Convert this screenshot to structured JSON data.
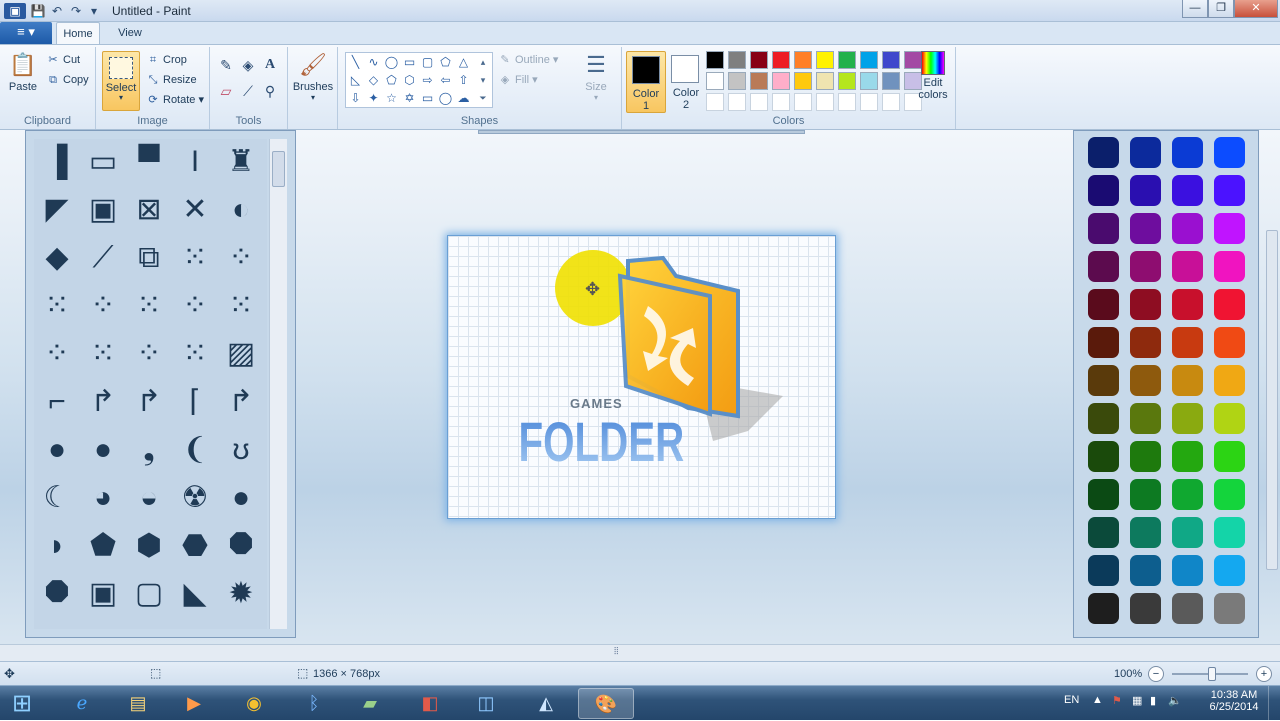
{
  "window": {
    "title": "Untitled - Paint",
    "file_menu": "≡ ▾",
    "minimize": "—",
    "maximize": "❐",
    "close": "✕"
  },
  "quick_access": [
    "💾",
    "↶",
    "↷",
    "▾"
  ],
  "tabs": [
    {
      "label": "Home",
      "active": true
    },
    {
      "label": "View",
      "active": false
    }
  ],
  "ribbon": {
    "clipboard": {
      "label": "Clipboard",
      "paste": "Paste",
      "cut": "Cut",
      "copy": "Copy"
    },
    "image": {
      "label": "Image",
      "select": "Select",
      "crop": "Crop",
      "resize": "Resize",
      "rotate": "Rotate"
    },
    "tools": {
      "label": "Tools"
    },
    "brushes": {
      "label": "Brushes"
    },
    "shapes": {
      "label": "Shapes",
      "outline": "Outline",
      "fill": "Fill",
      "size": "Size"
    },
    "colors": {
      "label": "Colors",
      "color1_line1": "Color",
      "color1_line2": "1",
      "color2_line1": "Color",
      "color2_line2": "2",
      "edit_line1": "Edit",
      "edit_line2": "colors",
      "color1": "#000000",
      "color2": "#ffffff",
      "palette_row1": [
        "#000000",
        "#7f7f7f",
        "#880015",
        "#ed1c24",
        "#ff7f27",
        "#fff200",
        "#22b14c",
        "#00a2e8",
        "#3f48cc",
        "#a349a4"
      ],
      "palette_row2": [
        "#ffffff",
        "#c3c3c3",
        "#b97a57",
        "#ffaec9",
        "#ffc90e",
        "#efe4b0",
        "#b5e61d",
        "#99d9ea",
        "#7092be",
        "#c8bfe7"
      ]
    }
  },
  "canvas_image": {
    "text_small": "GAMES",
    "text_big": "FOLDER"
  },
  "right_palette": [
    [
      "#0b1f6b",
      "#0c2a9c",
      "#0b3bd4",
      "#0c4cff"
    ],
    [
      "#1a0b72",
      "#2a0fb0",
      "#3b10e0",
      "#4b12ff"
    ],
    [
      "#4a0b6e",
      "#6e0d9e",
      "#9a10d0",
      "#c014ff"
    ],
    [
      "#5c0b4e",
      "#8e0d70",
      "#c81098",
      "#f014c0"
    ],
    [
      "#5a0b1c",
      "#8e0d22",
      "#c8102c",
      "#f01432"
    ],
    [
      "#5a1a0b",
      "#8e2a0d",
      "#c83a10",
      "#f04a14"
    ],
    [
      "#5a3a0b",
      "#8e5a0d",
      "#c88a10",
      "#f0a814"
    ],
    [
      "#3a4a0b",
      "#5a780d",
      "#8aaa10",
      "#b0d414"
    ],
    [
      "#1a4a0b",
      "#1e7a0d",
      "#24a810",
      "#2cd414"
    ],
    [
      "#0b4a14",
      "#0d7a22",
      "#10a830",
      "#14d43c"
    ],
    [
      "#0b4a3a",
      "#0d7a5e",
      "#10a886",
      "#14d4a8"
    ],
    [
      "#0b3a5a",
      "#0d5e8e",
      "#1086c8",
      "#14a8f0"
    ],
    [
      "#1e1e1e",
      "#3a3a3a",
      "#5a5a5a",
      "#7a7a7a"
    ]
  ],
  "status": {
    "move_icon": "✥",
    "select_icon": "⬚",
    "size_icon": "⬚",
    "dimensions": "1366 × 768px",
    "zoom": "100%",
    "zoom_out": "−",
    "zoom_in": "+"
  },
  "taskbar": {
    "start": "⊞",
    "language": "EN",
    "time": "10:38 AM",
    "date": "6/25/2014"
  }
}
